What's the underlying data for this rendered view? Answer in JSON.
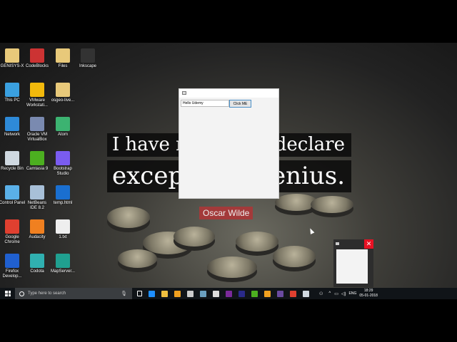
{
  "desktop": {
    "icons": [
      {
        "label": "GENISYS-X",
        "color": "#e8c97a"
      },
      {
        "label": "CodeBlocks",
        "color": "#c33"
      },
      {
        "label": "Files",
        "color": "#e8c97a"
      },
      {
        "label": "Inkscape",
        "color": "#333"
      },
      {
        "label": "This PC",
        "color": "#3aa0e0"
      },
      {
        "label": "VMware Workstati...",
        "color": "#f2b90c"
      },
      {
        "label": "osgeo-live...",
        "color": "#e8c97a"
      },
      {
        "label": "Network",
        "color": "#2e8ad8"
      },
      {
        "label": "Oracle VM VirtualBox",
        "color": "#7a8ab0"
      },
      {
        "label": "Atom",
        "color": "#3cb371"
      },
      {
        "label": "Recycle Bin",
        "color": "#cfd8e0"
      },
      {
        "label": "Camtasia 9",
        "color": "#4caf20"
      },
      {
        "label": "Bootstrap Studio",
        "color": "#7a5cf0"
      },
      {
        "label": "Control Panel",
        "color": "#5ab0e8"
      },
      {
        "label": "NetBeans IDE 8.2",
        "color": "#a8c0d8"
      },
      {
        "label": "temp.html",
        "color": "#1a6fd0"
      },
      {
        "label": "Google Chrome",
        "color": "#e04030"
      },
      {
        "label": "Audacity",
        "color": "#f08020"
      },
      {
        "label": "1.txt",
        "color": "#eee"
      },
      {
        "label": "Firefox Develop...",
        "color": "#2060d0"
      },
      {
        "label": "Codota",
        "color": "#30b0b0"
      },
      {
        "label": "MapServer...",
        "color": "#20a090"
      }
    ]
  },
  "quote": {
    "line1_left": "I have n",
    "line1_right": "declare",
    "line2_left": "excep",
    "line2_right": "enius.",
    "author": "Oscar Wilde"
  },
  "app_window": {
    "text_field_value": "Hello Udemy",
    "button_label": "Click ME"
  },
  "thumbnail": {
    "close_label": "✕"
  },
  "taskbar": {
    "search_placeholder": "Type here to search",
    "language": "ENG",
    "time": "18:29",
    "date": "05-01-2018",
    "apps": [
      "#1e8fff",
      "#f0c040",
      "#f0a020",
      "#ccc",
      "#6aa0c0",
      "#ddd",
      "#7a2a9a",
      "#2a2a8a",
      "#4caf20",
      "#f0a020",
      "#6a4aa0",
      "#e04030",
      "#d0d8e0"
    ]
  }
}
